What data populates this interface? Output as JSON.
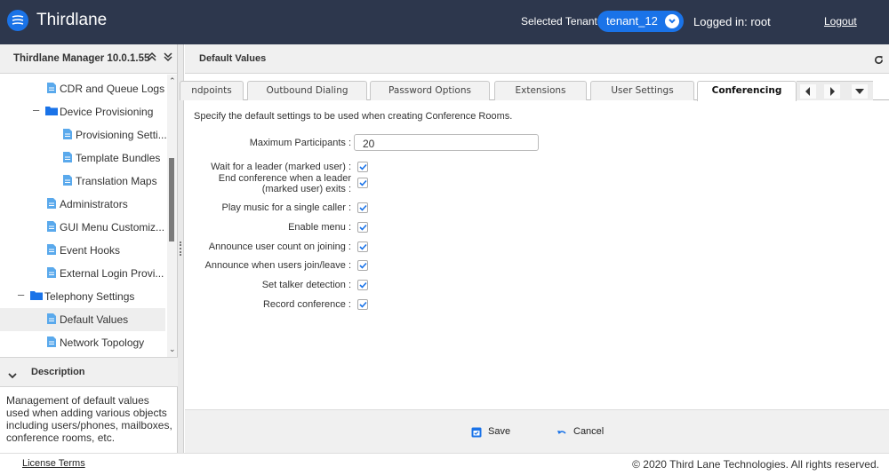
{
  "header": {
    "brand": "Thirdlane",
    "tenant_label": "Selected Tenant :",
    "tenant_value": "tenant_12",
    "logged_in": "Logged in: root",
    "logout": "Logout"
  },
  "sidebar": {
    "title": "Thirdlane Manager 10.0.1.55",
    "tree": [
      {
        "label": "CDR and Queue Logs",
        "type": "file",
        "level": 2,
        "selected": false
      },
      {
        "label": "Device Provisioning",
        "type": "folder",
        "level": 1,
        "expanded": true,
        "selected": false
      },
      {
        "label": "Provisioning Setti...",
        "type": "file",
        "level": 3,
        "selected": false
      },
      {
        "label": "Template Bundles",
        "type": "file",
        "level": 3,
        "selected": false
      },
      {
        "label": "Translation Maps",
        "type": "file",
        "level": 3,
        "selected": false
      },
      {
        "label": "Administrators",
        "type": "file",
        "level": 2,
        "selected": false
      },
      {
        "label": "GUI Menu Customiz...",
        "type": "file",
        "level": 2,
        "selected": false
      },
      {
        "label": "Event Hooks",
        "type": "file",
        "level": 2,
        "selected": false
      },
      {
        "label": "External Login Provi...",
        "type": "file",
        "level": 2,
        "selected": false
      },
      {
        "label": "Telephony Settings",
        "type": "folder",
        "level": 0,
        "expanded": true,
        "selected": false
      },
      {
        "label": "Default Values",
        "type": "file",
        "level": 2,
        "selected": true
      },
      {
        "label": "Network Topology",
        "type": "file",
        "level": 2,
        "selected": false
      }
    ],
    "description_title": "Description",
    "description_text": "Management of default values used when adding various objects including users/phones, mailboxes, conference rooms, etc."
  },
  "main": {
    "title": "Default Values",
    "tabs": [
      {
        "label": "ndpoints",
        "active": false
      },
      {
        "label": "Outbound Dialing",
        "active": false
      },
      {
        "label": "Password Options",
        "active": false
      },
      {
        "label": "Extensions",
        "active": false
      },
      {
        "label": "User Settings",
        "active": false
      },
      {
        "label": "Conferencing",
        "active": true
      }
    ],
    "intro": "Specify the default settings to be used when creating Conference Rooms.",
    "max_participants_label": "Maximum Participants :",
    "max_participants_value": "20",
    "checkboxes": [
      {
        "label": "Wait for a leader (marked user) :",
        "checked": true
      },
      {
        "label": "End conference when a leader (marked user) exits :",
        "checked": true
      },
      {
        "label": "Play music for a single caller :",
        "checked": true
      },
      {
        "label": "Enable menu :",
        "checked": true
      },
      {
        "label": "Announce user count on joining :",
        "checked": true
      },
      {
        "label": "Announce when users join/leave :",
        "checked": true
      },
      {
        "label": "Set talker detection :",
        "checked": true
      },
      {
        "label": "Record conference :",
        "checked": true
      }
    ],
    "save_label": "Save",
    "cancel_label": "Cancel"
  },
  "footer": {
    "license": "License Terms",
    "copyright": "© 2020 Third Lane Technologies. All rights reserved."
  },
  "colors": {
    "topbar": "#2d374d",
    "accent": "#1a73e8",
    "icon_file": "#5aa9ec"
  }
}
